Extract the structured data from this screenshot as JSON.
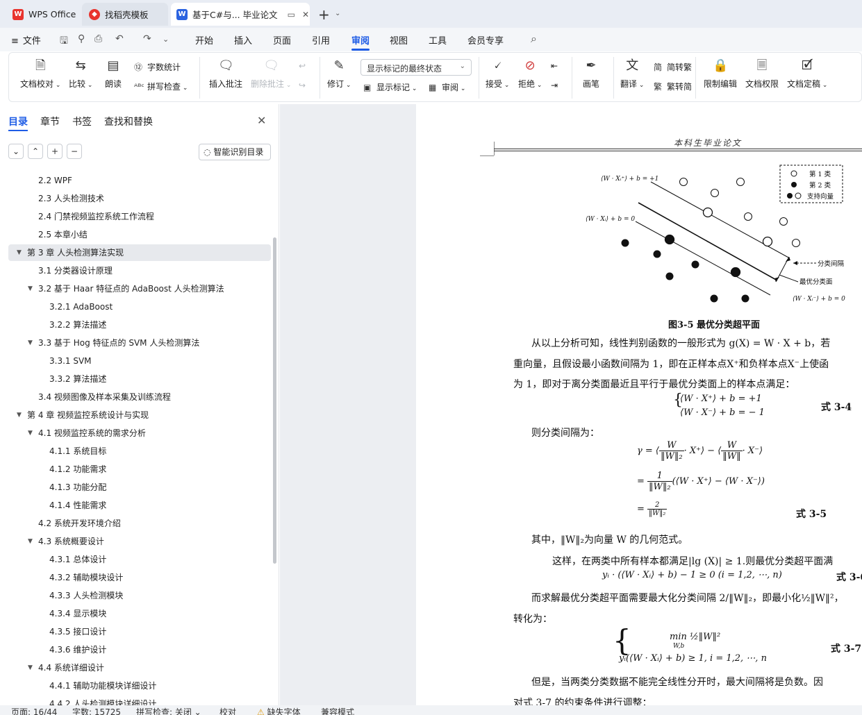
{
  "tabs": [
    {
      "label": "WPS Office"
    },
    {
      "label": "找稻壳模板"
    },
    {
      "label": "基于C#与... 毕业论文"
    }
  ],
  "menu": {
    "file": "文件",
    "items": [
      "开始",
      "插入",
      "页面",
      "引用",
      "审阅",
      "视图",
      "工具",
      "会员专享"
    ],
    "active": "审阅"
  },
  "ribbon": {
    "doc_proof": "文档校对",
    "compare": "比较",
    "read_aloud": "朗读",
    "word_count": "字数统计",
    "spell_check": "拼写检查",
    "insert_comment": "插入批注",
    "delete_comment": "删除批注",
    "revise": "修订",
    "display_mode": "显示标记的最终状态",
    "show_markup": "显示标记",
    "review": "审阅",
    "accept": "接受",
    "reject": "拒绝",
    "pen": "画笔",
    "translate": "翻译",
    "to_traditional": "简转繁",
    "to_simplified": "繁转简",
    "restrict_edit": "限制编辑",
    "doc_permission": "文档权限",
    "doc_finalize": "文档定稿"
  },
  "nav": {
    "tabs": [
      "目录",
      "章节",
      "书签",
      "查找和替换"
    ],
    "smart_toc": "智能识别目录",
    "toc": [
      {
        "label": "2.2 WPF"
      },
      {
        "label": "2.3 人头检测技术"
      },
      {
        "label": "2.4 门禁视频监控系统工作流程"
      },
      {
        "label": "2.5 本章小结"
      },
      {
        "label": "第 3 章 人头检测算法实现"
      },
      {
        "label": "3.1 分类器设计原理"
      },
      {
        "label": "3.2 基于 Haar 特征点的 AdaBoost 人头检测算法"
      },
      {
        "label": "3.2.1 AdaBoost"
      },
      {
        "label": "3.2.2 算法描述"
      },
      {
        "label": "3.3 基于 Hog 特征点的 SVM 人头检测算法"
      },
      {
        "label": "3.3.1 SVM"
      },
      {
        "label": "3.3.2 算法描述"
      },
      {
        "label": "3.4 视频图像及样本采集及训练流程"
      },
      {
        "label": "第 4 章 视频监控系统设计与实现"
      },
      {
        "label": "4.1 视频监控系统的需求分析"
      },
      {
        "label": "4.1.1 系统目标"
      },
      {
        "label": "4.1.2 功能需求"
      },
      {
        "label": "4.1.3 功能分配"
      },
      {
        "label": "4.1.4 性能需求"
      },
      {
        "label": "4.2 系统开发环境介绍"
      },
      {
        "label": "4.3 系统概要设计"
      },
      {
        "label": "4.3.1 总体设计"
      },
      {
        "label": "4.3.2 辅助模块设计"
      },
      {
        "label": "4.3.3 人头检测模块"
      },
      {
        "label": "4.3.4 显示模块"
      },
      {
        "label": "4.3.5 接口设计"
      },
      {
        "label": "4.3.6 维护设计"
      },
      {
        "label": "4.4 系统详细设计"
      },
      {
        "label": "4.4.1 辅助功能模块详细设计"
      },
      {
        "label": "4.4.2 人头检测模块详细设计"
      }
    ]
  },
  "doc": {
    "header": "本科生毕业论文",
    "figure": {
      "legend_class1": "第 1 类",
      "legend_class2": "第 2 类",
      "legend_sv": "支持向量",
      "label_top": "⟨W · Xᵢ⁺⟩ + b = +1",
      "label_mid": "⟨W · Xᵢ⟩ + b = 0",
      "label_bottom": "⟨W · Xᵢ⁻⟩ + b = 0",
      "label_margin": "分类间隔",
      "label_hyperplane": "最优分类面",
      "caption": "图3-5 最优分类超平面"
    },
    "para1_a": "从以上分析可知，线性判别函数的一般形式为  g(X) = W · X + b，若",
    "para1_b": "重向量，且假设最小函数间隔为 1，即在正样本点X⁺和负样本点X⁻上使函",
    "para1_c": "为 1，即对于离分类面最近且平行于最优分类面上的样本点满足：",
    "eq34_line1": "⟨W · X⁺⟩ + b = +1",
    "eq34_line2": "⟨W · X⁻⟩ + b = − 1",
    "eq34_label": "式 3-4",
    "margin_text": "则分类间隔为：",
    "eq35_gamma": "γ = ⟨",
    "eq35_w": "W",
    "eq35_normw2": "‖W‖₂",
    "eq35_normw": "‖W‖",
    "eq35_x_plus": "· X⁺⟩ − ⟨",
    "eq35_x_minus": "· X⁻⟩",
    "eq35_one": "1",
    "eq35_two": "2",
    "eq35_line2": "(⟨W · X⁺⟩ − ⟨W · X⁻⟩)",
    "eq35_label": "式 3-5",
    "norm_text": "其中，‖W‖₂为向量 W 的几何范式。",
    "para2": "这样，在两类中所有样本都满足|lg (X)| ≥ 1.则最优分类超平面满",
    "eq36": "yᵢ · (⟨W · Xᵢ⟩ + b) − 1 ≥ 0   (i = 1,2, ⋯, n)",
    "eq36_label": "式 3-6",
    "para3": "而求解最优分类超平面需要最大化分类间隔 2/‖W‖₂，即最小化½‖W‖²，",
    "para3_b": "转化为：",
    "eq37_line1": "min ½‖W‖²",
    "eq37_sub": "W,b",
    "eq37_line2": "yᵢ(⟨W · Xᵢ⟩ + b) ≥ 1, i = 1,2, ⋯, n",
    "eq37_label": "式 3-7",
    "para4": "但是，当两类分类数据不能完全线性分开时，最大间隔将是负数。因",
    "para4_b": "对式 3-7 的约束条件进行调整："
  },
  "status": {
    "page": "页面: 16/44",
    "words": "字数: 15725",
    "spell": "拼写检查: 关闭",
    "proof": "校对",
    "missing_font": "缺失字体",
    "compat": "兼容模式"
  },
  "colors": {
    "accent": "#1e5ce6",
    "tab_bar": "#e9edf4",
    "doc_bg": "#eceef2"
  }
}
